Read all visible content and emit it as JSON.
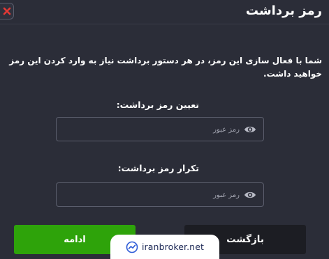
{
  "modal": {
    "title": "رمز برداشت",
    "close_icon": "close-x-icon",
    "description": "شما با فعال سازی این رمز، در هر دستور برداشت نیاز به وارد کردن این رمز خواهید داشت.",
    "fields": [
      {
        "label": "تعیین رمز برداشت:",
        "placeholder": "رمز عبور",
        "icon": "eye-icon"
      },
      {
        "label": "تکرار رمز برداشت:",
        "placeholder": "رمز عبور",
        "icon": "eye-icon"
      }
    ],
    "buttons": {
      "continue_label": "ادامه",
      "back_label": "بازگشت"
    }
  },
  "watermark": {
    "text": "iranbroker.net",
    "icon": "iranbroker-logo-icon"
  },
  "colors": {
    "background": "#2b2d38",
    "continue_button": "#2ea30a",
    "back_button": "#1c1d23",
    "close_accent": "#e53935"
  }
}
